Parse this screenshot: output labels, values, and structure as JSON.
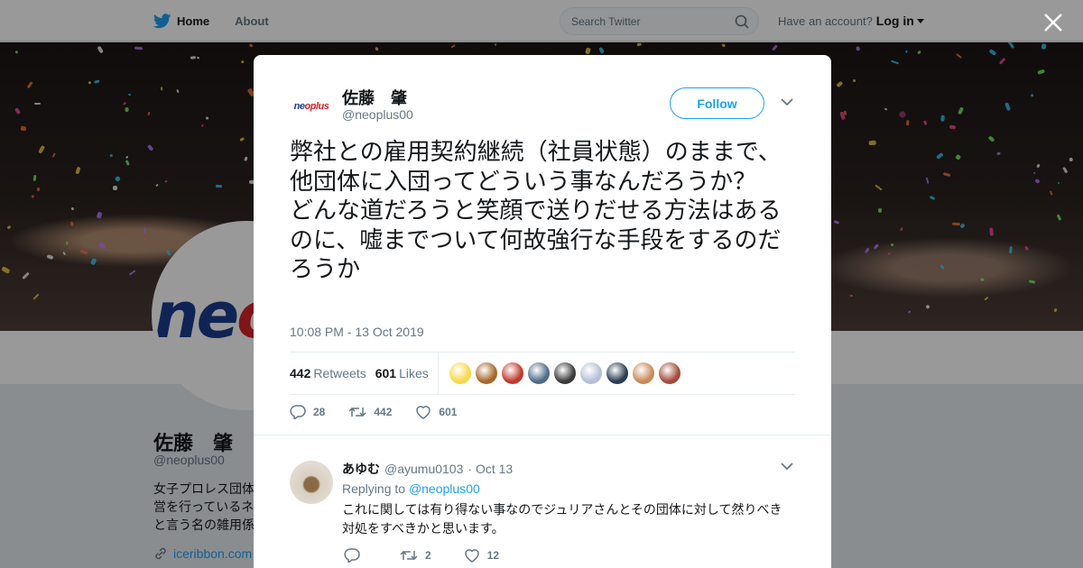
{
  "nav": {
    "home_label": "Home",
    "about_label": "About",
    "search_placeholder": "Search Twitter",
    "have_account": "Have an account?",
    "login_label": "Log in"
  },
  "profile": {
    "name": "佐藤　肇",
    "handle": "@neoplus00",
    "bio": "女子プロレス団体\n営を行っているネ\nと言う名の雑用係",
    "link": "iceribbon.com",
    "avatar_logo": {
      "part1": "ne",
      "part2": "opl"
    }
  },
  "tweet": {
    "author_name": "佐藤　肇",
    "author_handle": "@neoplus00",
    "avatar_logo": {
      "part1": "ne",
      "part2": "oplus"
    },
    "follow_label": "Follow",
    "text": "弊社との雇用契約継続（社員状態）のままで、他団体に入団ってどういう事なんだろうか？\nどんな道だろうと笑顔で送りだせる方法はあるのに、嘘までついて何故強行な手段をするのだろうか",
    "timestamp": "10:08 PM - 13 Oct 2019",
    "retweets_count": "442",
    "retweets_label": "Retweets",
    "likes_count": "601",
    "likes_label": "Likes",
    "reply_count": "28",
    "retweet_action_count": "442",
    "like_action_count": "601",
    "liker_colors": [
      "#f6d94a",
      "#a5682a",
      "#c0392b",
      "#4f6b8a",
      "#3a3a3a",
      "#b5bfd6",
      "#2b3d52",
      "#c98a5a",
      "#a34b3a"
    ]
  },
  "reply": {
    "name": "あゆむ",
    "handle": "@ayumu0103",
    "date": "· Oct 13",
    "replying_to_label": "Replying to",
    "replying_to_handle": "@neoplus00",
    "text": "これに関しては有り得ない事なのでジュリアさんとその団体に対して然りべき対処をすべきかと思います。",
    "reply_count": "",
    "retweet_count": "2",
    "like_count": "12"
  },
  "colors": {
    "accent": "#1da1f2",
    "text_primary": "#14171a",
    "text_secondary": "#657786"
  }
}
